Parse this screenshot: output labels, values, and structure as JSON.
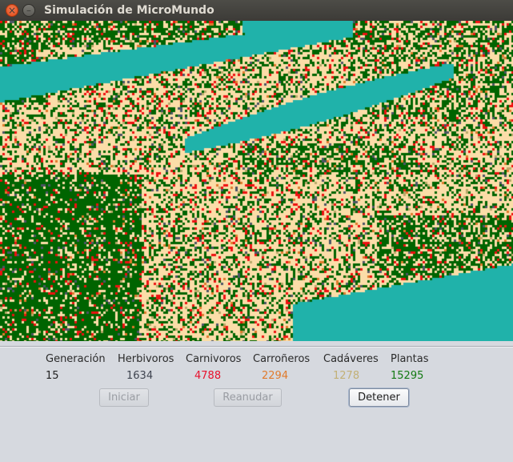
{
  "window": {
    "title": "Simulación de MicroMundo",
    "close_glyph": "×",
    "minimize_glyph": "–"
  },
  "world": {
    "colors": {
      "ground": "#fbdda8",
      "water": "#20b2aa",
      "plant": "#006400",
      "herbivore": "#4d5566",
      "carnivore": "#ee1111",
      "scavenger": "#e07a2c",
      "corpse": "#b8a96a"
    }
  },
  "stats": {
    "labels": [
      "Generación",
      "Herbivoros",
      "Carnivoros",
      "Carroñeros",
      "Cadáveres",
      "Plantas"
    ],
    "values": [
      "15",
      "1634",
      "4788",
      "2294",
      "1278",
      "15295"
    ],
    "value_colors": [
      "#222222",
      "#3f4450",
      "#e8112d",
      "#e07a2c",
      "#c2b076",
      "#137a13"
    ]
  },
  "buttons": {
    "start_label": "Iniciar",
    "resume_label": "Reanudar",
    "stop_label": "Detener"
  }
}
